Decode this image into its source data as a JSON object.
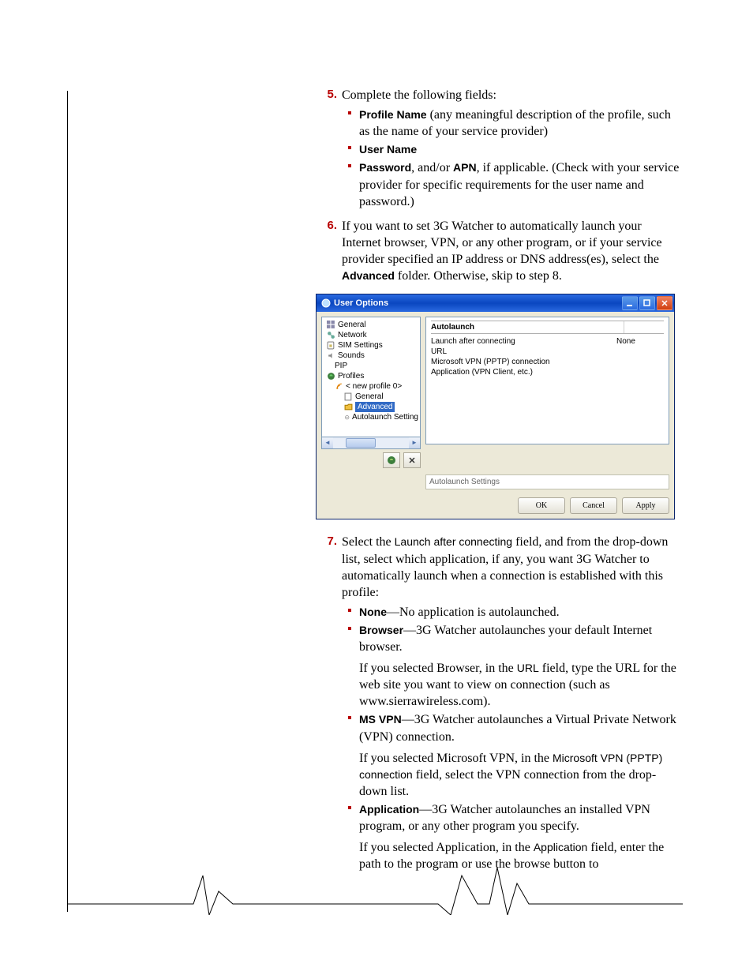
{
  "steps": {
    "s5": {
      "num": "5.",
      "intro": "Complete the following fields:",
      "b1_bold": "Profile Name",
      "b1_rest": " (any meaningful description of the profile, such as the name of your service provider)",
      "b2_bold": "User Name",
      "b3_bold1": "Password",
      "b3_mid": ", and/or ",
      "b3_bold2": "APN",
      "b3_rest": ", if applicable. (Check with your service provider for specific requirements for the user name and password.)"
    },
    "s6": {
      "num": "6.",
      "t1": "If you want to set 3G Watcher to automatically launch your Internet browser, VPN, or any other program, or if your service provider specified an IP address or DNS address(es), select the ",
      "bold": "Advanced",
      "t2": " folder. Otherwise, skip to step 8."
    },
    "s7": {
      "num": "7.",
      "t1": "Select the ",
      "s1": "Launch after connecting",
      "t2": " field, and from the drop-down list, select which application, if any, you want 3G Watcher to automatically launch when a connection is established with this profile:",
      "b_none_bold": "None",
      "b_none_rest": "—No application is autolaunched.",
      "b_browser_bold": "Browser",
      "b_browser_rest": "—3G Watcher autolaunches your default Internet browser.",
      "note_browser_1": "If you selected Browser, in the ",
      "note_browser_s": "URL",
      "note_browser_2": " field, type the URL for the web site you want to view on connection (such as www.sierrawireless.com).",
      "b_msvpn_bold": "MS VPN",
      "b_msvpn_rest": "—3G Watcher autolaunches a Virtual Private Network (VPN) connection.",
      "note_msvpn_1": "If you selected Microsoft VPN, in the ",
      "note_msvpn_s": "Microsoft VPN (PPTP) connection",
      "note_msvpn_2": " field, select the VPN connection from the drop-down list.",
      "b_app_bold": "Application",
      "b_app_rest": "—3G Watcher autolaunches an installed VPN program, or any other program you specify.",
      "note_app_1": "If you selected Application, in the ",
      "note_app_s": "Application",
      "note_app_2": " field, enter the path to the program or use the browse button to"
    }
  },
  "dialog": {
    "title": "User Options",
    "tree": {
      "general": "General",
      "network": "Network",
      "sim": "SIM Settings",
      "sounds": "Sounds",
      "pip": "PIP",
      "profiles": "Profiles",
      "newprofile": "< new profile 0>",
      "pgeneral": "General",
      "advanced": "Advanced",
      "autolaunch": "Autolaunch Setting"
    },
    "panel": {
      "head": "Autolaunch",
      "r1l": "Launch after connecting",
      "r1v": "None",
      "r2l": "URL",
      "r3l": "Microsoft VPN (PPTP) connection",
      "r4l": "Application (VPN Client, etc.)"
    },
    "status": "Autolaunch Settings",
    "buttons": {
      "ok": "OK",
      "cancel": "Cancel",
      "apply": "Apply"
    }
  }
}
